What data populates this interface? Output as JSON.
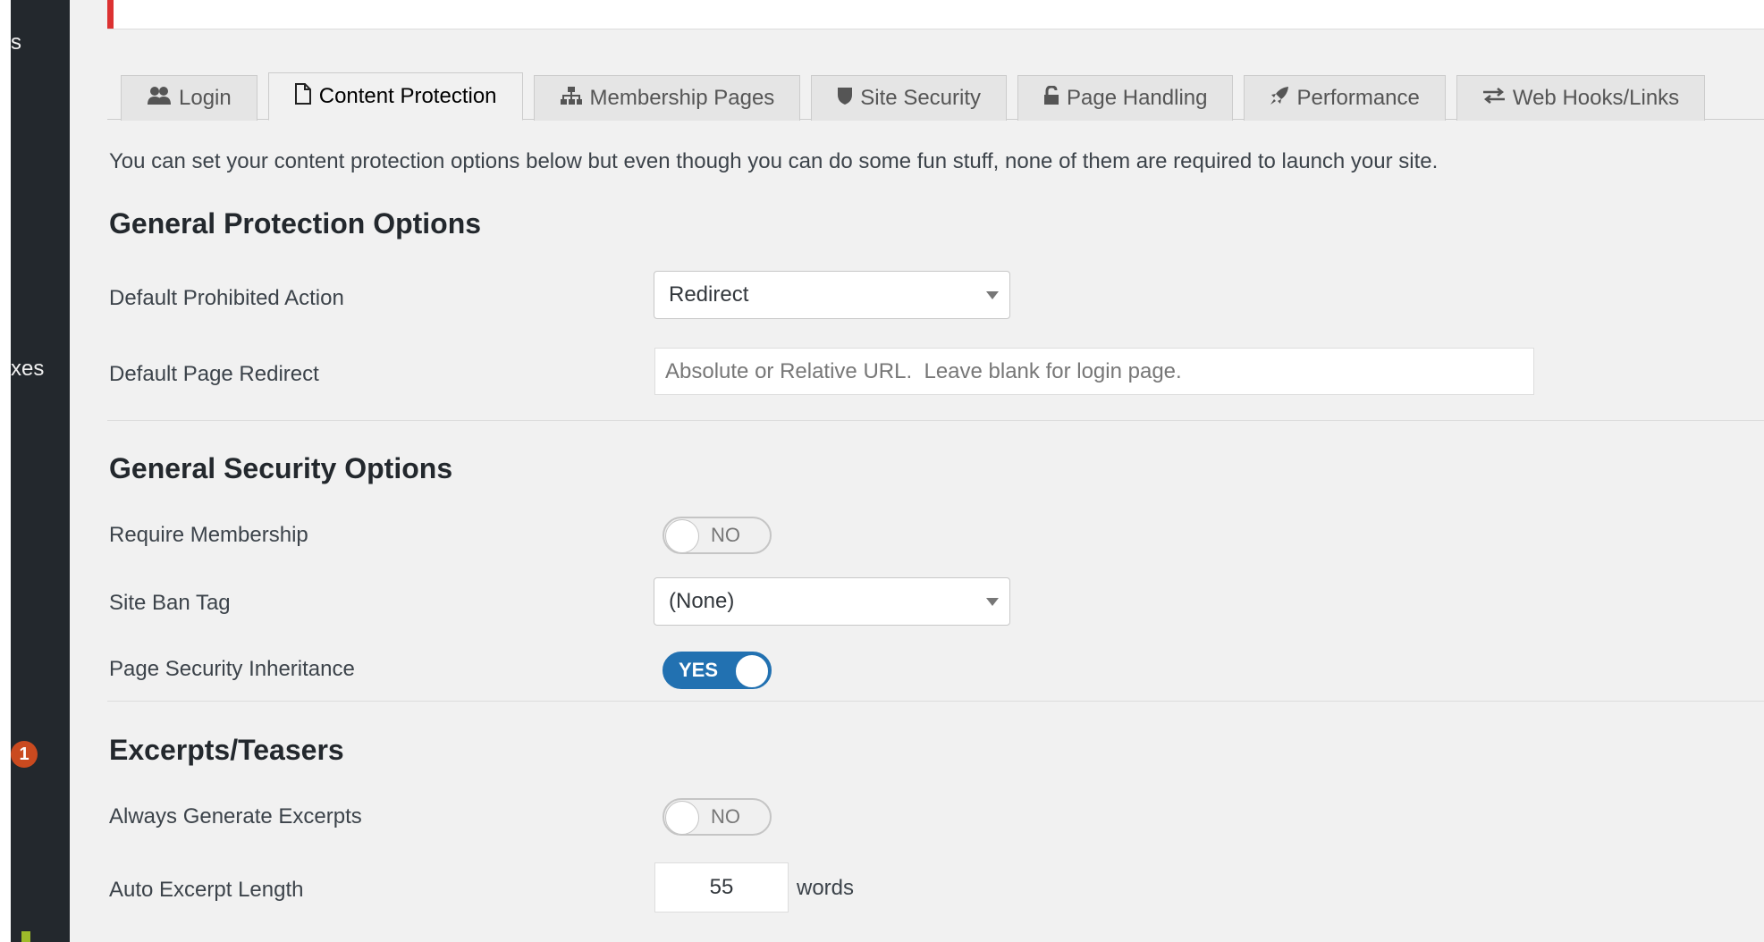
{
  "sidebar": {
    "fragments": [
      "s",
      "xes"
    ],
    "badge_count": "1"
  },
  "tabs": [
    {
      "label": "Login",
      "icon": "users-icon",
      "active": false
    },
    {
      "label": "Content Protection",
      "icon": "document-icon",
      "active": true
    },
    {
      "label": "Membership Pages",
      "icon": "sitemap-icon",
      "active": false
    },
    {
      "label": "Site Security",
      "icon": "shield-icon",
      "active": false
    },
    {
      "label": "Page Handling",
      "icon": "lock-icon",
      "active": false
    },
    {
      "label": "Performance",
      "icon": "rocket-icon",
      "active": false
    },
    {
      "label": "Web Hooks/Links",
      "icon": "exchange-icon",
      "active": false
    }
  ],
  "intro": "You can set your content protection options below but even though you can do some fun stuff, none of them are required to launch your site.",
  "general_protection": {
    "title": "General Protection Options",
    "default_prohibited_action": {
      "label": "Default Prohibited Action",
      "value": "Redirect"
    },
    "default_page_redirect": {
      "label": "Default Page Redirect",
      "placeholder": "Absolute or Relative URL.  Leave blank for login page.",
      "value": ""
    }
  },
  "general_security": {
    "title": "General Security Options",
    "require_membership": {
      "label": "Require Membership",
      "state": "NO"
    },
    "site_ban_tag": {
      "label": "Site Ban Tag",
      "value": "(None)"
    },
    "page_security_inheritance": {
      "label": "Page Security Inheritance",
      "state": "YES"
    }
  },
  "excerpts": {
    "title": "Excerpts/Teasers",
    "always_generate": {
      "label": "Always Generate Excerpts",
      "state": "NO"
    },
    "auto_length": {
      "label": "Auto Excerpt Length",
      "value": "55",
      "suffix": "words"
    }
  },
  "colors": {
    "toggle_on": "#2271b1",
    "notice_accent": "#dc3232",
    "badge": "#ca4a1f"
  }
}
